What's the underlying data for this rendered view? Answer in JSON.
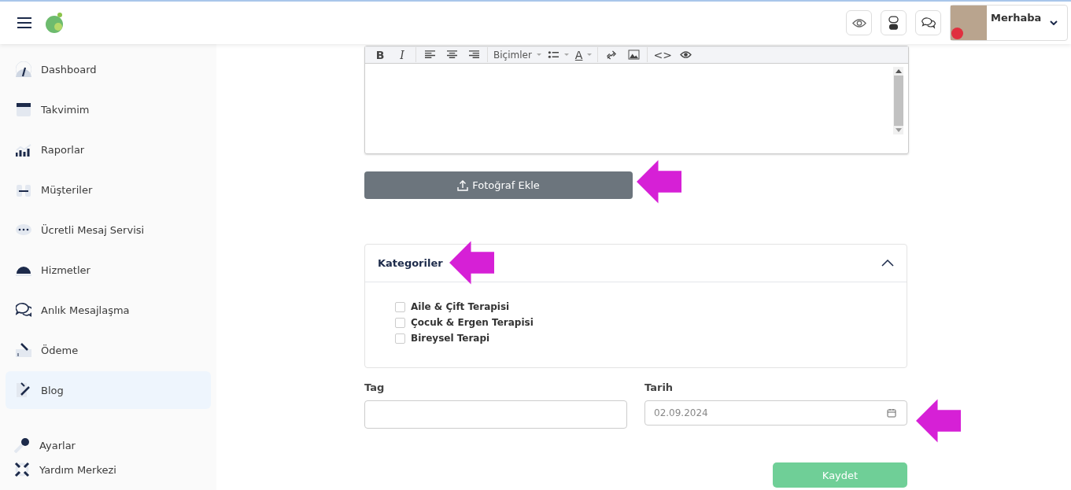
{
  "header": {
    "user": {
      "greeting": "Merhaba",
      "online": true
    }
  },
  "sidebar": {
    "items": [
      {
        "label": "Dashboard",
        "selected": false
      },
      {
        "label": "Takvimim",
        "selected": false
      },
      {
        "label": "Raporlar",
        "selected": false
      },
      {
        "label": "Müşteriler",
        "selected": false
      },
      {
        "label": "Ücretli Mesaj Servisi",
        "selected": false
      },
      {
        "label": "Hizmetler",
        "selected": false
      },
      {
        "label": "Anlık Mesajlaşma",
        "selected": false
      },
      {
        "label": "Ödeme",
        "selected": false
      },
      {
        "label": "Blog",
        "selected": true
      }
    ],
    "bottom_items": [
      {
        "label": "Ayarlar"
      },
      {
        "label": "Yardım Merkezi"
      }
    ]
  },
  "editor": {
    "toolbar": [
      {
        "kind": "bold",
        "text": "B"
      },
      {
        "kind": "italic",
        "text": "I"
      },
      {
        "kind": "sep"
      },
      {
        "kind": "alignleft"
      },
      {
        "kind": "aligncenter"
      },
      {
        "kind": "alignright"
      },
      {
        "kind": "sep"
      },
      {
        "kind": "formats",
        "text": "Biçimler"
      },
      {
        "kind": "bullets"
      },
      {
        "kind": "color",
        "text": "A"
      },
      {
        "kind": "sep"
      },
      {
        "kind": "link"
      },
      {
        "kind": "image"
      },
      {
        "kind": "sep"
      },
      {
        "kind": "code",
        "text": "<>"
      },
      {
        "kind": "preview"
      }
    ]
  },
  "upload_button": {
    "label": "Fotoğraf Ekle"
  },
  "categories": {
    "title": "Kategoriler",
    "expanded": true,
    "items": [
      {
        "label": "Aile & Çift Terapisi",
        "checked": false
      },
      {
        "label": "Çocuk & Ergen Terapisi",
        "checked": false
      },
      {
        "label": "Bireysel Terapi",
        "checked": false
      }
    ]
  },
  "tag": {
    "label": "Tag"
  },
  "date": {
    "label": "Tarih",
    "value": "02.09.2024"
  },
  "save_button": {
    "label": "Kaydet"
  }
}
